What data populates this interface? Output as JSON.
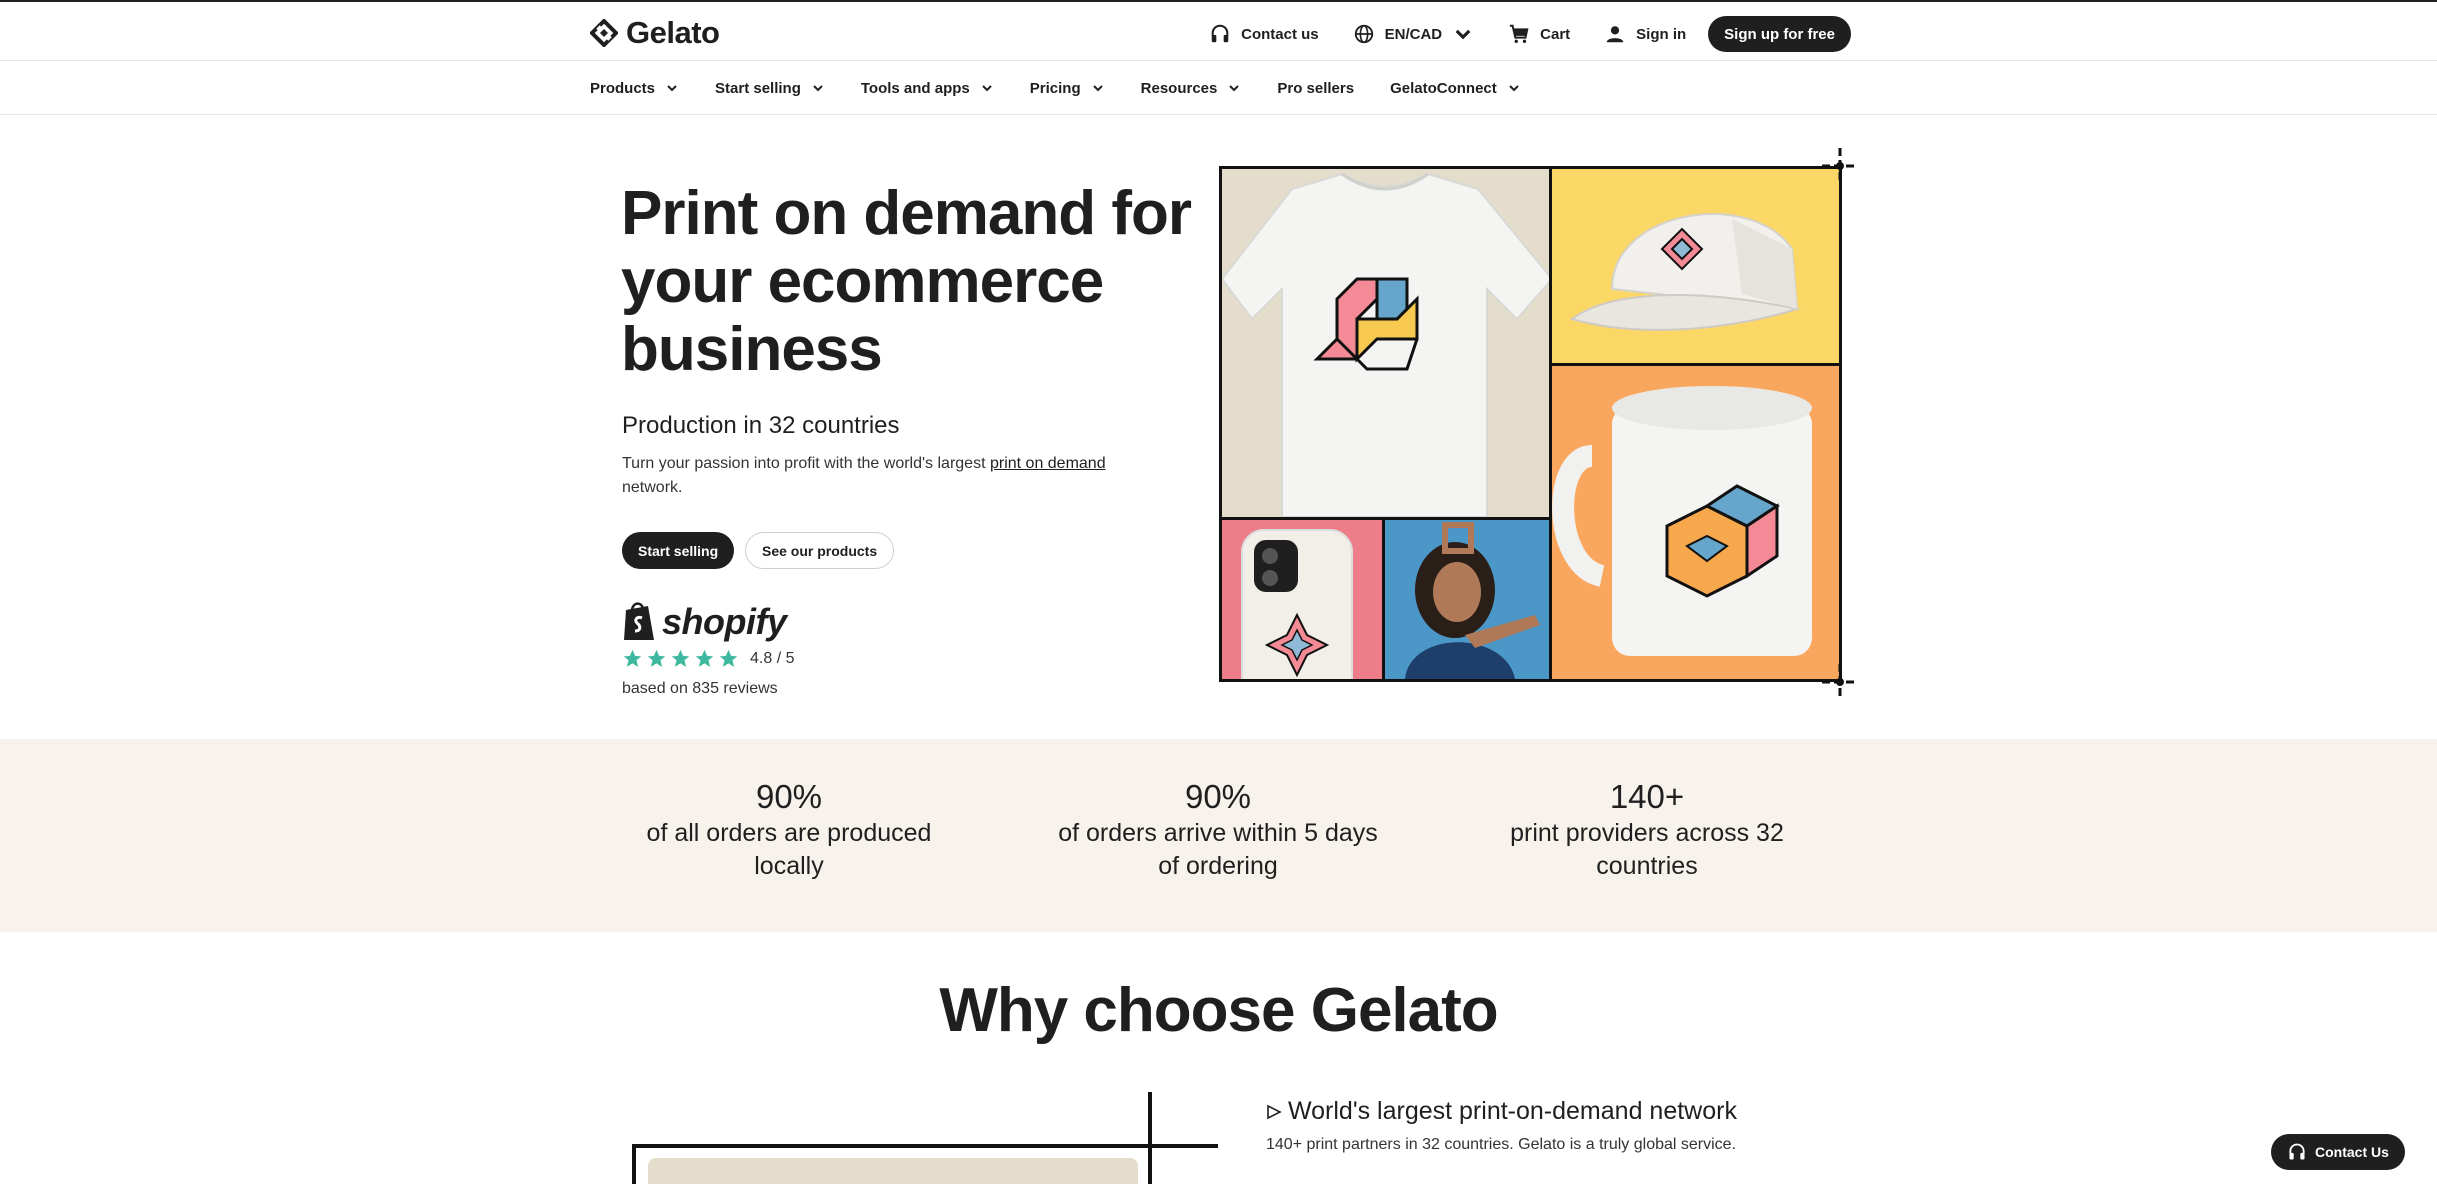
{
  "brand": {
    "name": "Gelato"
  },
  "topbar": {
    "contact": "Contact us",
    "locale": "EN/CAD",
    "cart": "Cart",
    "signin": "Sign in",
    "signup": "Sign up for free"
  },
  "nav": {
    "items": [
      {
        "label": "Products",
        "dropdown": true
      },
      {
        "label": "Start selling",
        "dropdown": true
      },
      {
        "label": "Tools and apps",
        "dropdown": true
      },
      {
        "label": "Pricing",
        "dropdown": true
      },
      {
        "label": "Resources",
        "dropdown": true
      },
      {
        "label": "Pro sellers",
        "dropdown": false
      },
      {
        "label": "GelatoConnect",
        "dropdown": true
      }
    ]
  },
  "hero": {
    "title": "Print on demand for your ecommerce business",
    "subtitle": "Production in 32 countries",
    "desc_before": "Turn your passion into profit with the world's largest ",
    "desc_link": "print on demand",
    "desc_after": " network.",
    "cta_primary": "Start selling",
    "cta_secondary": "See our products",
    "shopify_word": "shopify",
    "rating": "4.8 / 5",
    "stars": 5,
    "reviews": "based on 835 reviews"
  },
  "stats": [
    {
      "value": "90%",
      "label": "of all orders are produced locally"
    },
    {
      "value": "90%",
      "label": "of orders arrive within 5 days of ordering"
    },
    {
      "value": "140+",
      "label": "print providers across 32 countries"
    }
  ],
  "why": {
    "title": "Why choose Gelato",
    "heading": "World's largest print-on-demand network",
    "text": "140+ print partners in 32 countries. Gelato is a truly global service."
  },
  "contact_float": "Contact Us",
  "colors": {
    "dark": "#1f1f1f",
    "stats_bg": "#f7f3ec",
    "star": "#3fb8a0",
    "tile_beige": "#e4ddcb",
    "tile_yellow": "#fbd766",
    "tile_orange": "#f9a65e",
    "tile_pink": "#ee7d8a",
    "tile_blue": "#4b98c8"
  },
  "icons": {
    "logo": "gelato-logo-icon",
    "contact": "headset-icon",
    "locale": "globe-icon",
    "cart": "cart-icon",
    "signin": "user-icon",
    "dropdown": "chevron-down-icon",
    "star": "star-icon"
  }
}
